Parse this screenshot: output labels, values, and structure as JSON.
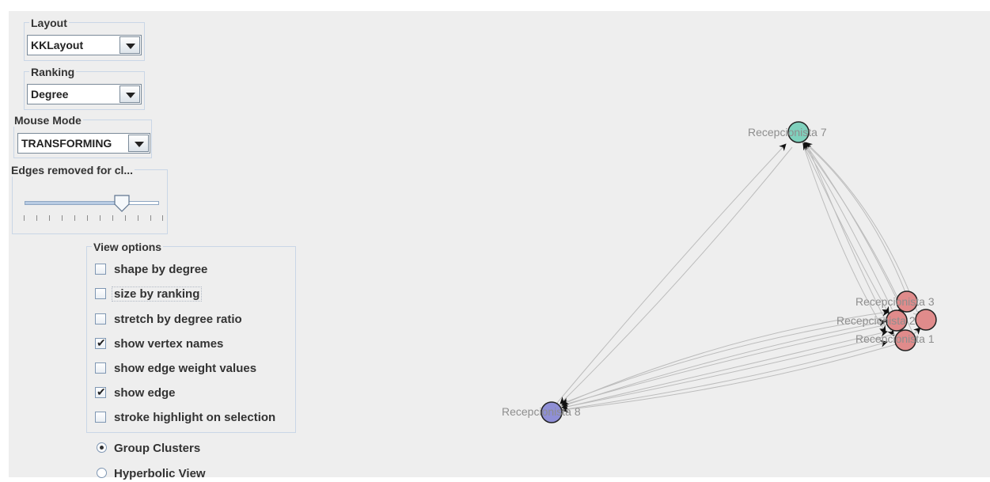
{
  "controls": {
    "layout": {
      "legend": "Layout",
      "selected": "KKLayout"
    },
    "ranking": {
      "legend": "Ranking",
      "selected": "Degree"
    },
    "mouse_mode": {
      "legend": "Mouse Mode",
      "selected": "TRANSFORMING"
    },
    "edges_removed": {
      "legend": "Edges removed for cl...",
      "slider_fraction": 0.73
    }
  },
  "view_options": {
    "legend": "View options",
    "items": [
      {
        "label": "shape by degree",
        "checked": false
      },
      {
        "label": "size by ranking",
        "checked": false
      },
      {
        "label": "stretch by degree ratio",
        "checked": false
      },
      {
        "label": "show vertex names",
        "checked": true
      },
      {
        "label": "show edge weight values",
        "checked": false
      },
      {
        "label": "show edge",
        "checked": true
      },
      {
        "label": "stroke highlight on selection",
        "checked": false
      }
    ],
    "check_glyph": "✔"
  },
  "view_mode": {
    "items": [
      {
        "label": "Group Clusters",
        "selected": true
      },
      {
        "label": "Hyperbolic View",
        "selected": false
      }
    ]
  },
  "graph": {
    "vertices": [
      {
        "name": "Recepcionista 7",
        "color": "#7fd1bd"
      },
      {
        "name": "Recepcionista 3",
        "color": "#e08b8b"
      },
      {
        "name": "Recepcionista 2",
        "color": "#e08b8b"
      },
      {
        "name": "Recepcionista 1",
        "color": "#e08b8b"
      },
      {
        "name": "Recepcionista 8",
        "color": "#8f8fd6"
      }
    ],
    "edge_color": "#bcbcbc"
  }
}
